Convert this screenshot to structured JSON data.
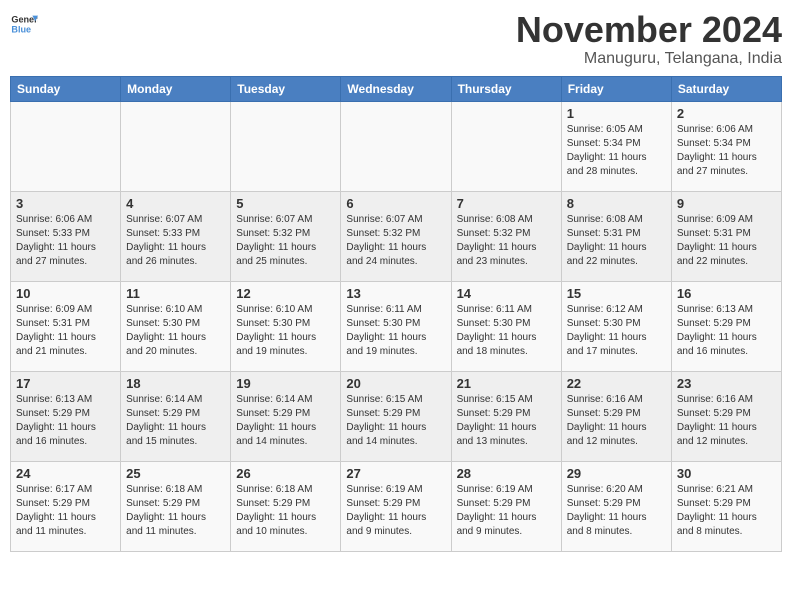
{
  "header": {
    "logo_line1": "General",
    "logo_line2": "Blue",
    "month": "November 2024",
    "location": "Manuguru, Telangana, India"
  },
  "weekdays": [
    "Sunday",
    "Monday",
    "Tuesday",
    "Wednesday",
    "Thursday",
    "Friday",
    "Saturday"
  ],
  "weeks": [
    [
      {
        "day": "",
        "info": ""
      },
      {
        "day": "",
        "info": ""
      },
      {
        "day": "",
        "info": ""
      },
      {
        "day": "",
        "info": ""
      },
      {
        "day": "",
        "info": ""
      },
      {
        "day": "1",
        "info": "Sunrise: 6:05 AM\nSunset: 5:34 PM\nDaylight: 11 hours\nand 28 minutes."
      },
      {
        "day": "2",
        "info": "Sunrise: 6:06 AM\nSunset: 5:34 PM\nDaylight: 11 hours\nand 27 minutes."
      }
    ],
    [
      {
        "day": "3",
        "info": "Sunrise: 6:06 AM\nSunset: 5:33 PM\nDaylight: 11 hours\nand 27 minutes."
      },
      {
        "day": "4",
        "info": "Sunrise: 6:07 AM\nSunset: 5:33 PM\nDaylight: 11 hours\nand 26 minutes."
      },
      {
        "day": "5",
        "info": "Sunrise: 6:07 AM\nSunset: 5:32 PM\nDaylight: 11 hours\nand 25 minutes."
      },
      {
        "day": "6",
        "info": "Sunrise: 6:07 AM\nSunset: 5:32 PM\nDaylight: 11 hours\nand 24 minutes."
      },
      {
        "day": "7",
        "info": "Sunrise: 6:08 AM\nSunset: 5:32 PM\nDaylight: 11 hours\nand 23 minutes."
      },
      {
        "day": "8",
        "info": "Sunrise: 6:08 AM\nSunset: 5:31 PM\nDaylight: 11 hours\nand 22 minutes."
      },
      {
        "day": "9",
        "info": "Sunrise: 6:09 AM\nSunset: 5:31 PM\nDaylight: 11 hours\nand 22 minutes."
      }
    ],
    [
      {
        "day": "10",
        "info": "Sunrise: 6:09 AM\nSunset: 5:31 PM\nDaylight: 11 hours\nand 21 minutes."
      },
      {
        "day": "11",
        "info": "Sunrise: 6:10 AM\nSunset: 5:30 PM\nDaylight: 11 hours\nand 20 minutes."
      },
      {
        "day": "12",
        "info": "Sunrise: 6:10 AM\nSunset: 5:30 PM\nDaylight: 11 hours\nand 19 minutes."
      },
      {
        "day": "13",
        "info": "Sunrise: 6:11 AM\nSunset: 5:30 PM\nDaylight: 11 hours\nand 19 minutes."
      },
      {
        "day": "14",
        "info": "Sunrise: 6:11 AM\nSunset: 5:30 PM\nDaylight: 11 hours\nand 18 minutes."
      },
      {
        "day": "15",
        "info": "Sunrise: 6:12 AM\nSunset: 5:30 PM\nDaylight: 11 hours\nand 17 minutes."
      },
      {
        "day": "16",
        "info": "Sunrise: 6:13 AM\nSunset: 5:29 PM\nDaylight: 11 hours\nand 16 minutes."
      }
    ],
    [
      {
        "day": "17",
        "info": "Sunrise: 6:13 AM\nSunset: 5:29 PM\nDaylight: 11 hours\nand 16 minutes."
      },
      {
        "day": "18",
        "info": "Sunrise: 6:14 AM\nSunset: 5:29 PM\nDaylight: 11 hours\nand 15 minutes."
      },
      {
        "day": "19",
        "info": "Sunrise: 6:14 AM\nSunset: 5:29 PM\nDaylight: 11 hours\nand 14 minutes."
      },
      {
        "day": "20",
        "info": "Sunrise: 6:15 AM\nSunset: 5:29 PM\nDaylight: 11 hours\nand 14 minutes."
      },
      {
        "day": "21",
        "info": "Sunrise: 6:15 AM\nSunset: 5:29 PM\nDaylight: 11 hours\nand 13 minutes."
      },
      {
        "day": "22",
        "info": "Sunrise: 6:16 AM\nSunset: 5:29 PM\nDaylight: 11 hours\nand 12 minutes."
      },
      {
        "day": "23",
        "info": "Sunrise: 6:16 AM\nSunset: 5:29 PM\nDaylight: 11 hours\nand 12 minutes."
      }
    ],
    [
      {
        "day": "24",
        "info": "Sunrise: 6:17 AM\nSunset: 5:29 PM\nDaylight: 11 hours\nand 11 minutes."
      },
      {
        "day": "25",
        "info": "Sunrise: 6:18 AM\nSunset: 5:29 PM\nDaylight: 11 hours\nand 11 minutes."
      },
      {
        "day": "26",
        "info": "Sunrise: 6:18 AM\nSunset: 5:29 PM\nDaylight: 11 hours\nand 10 minutes."
      },
      {
        "day": "27",
        "info": "Sunrise: 6:19 AM\nSunset: 5:29 PM\nDaylight: 11 hours\nand 9 minutes."
      },
      {
        "day": "28",
        "info": "Sunrise: 6:19 AM\nSunset: 5:29 PM\nDaylight: 11 hours\nand 9 minutes."
      },
      {
        "day": "29",
        "info": "Sunrise: 6:20 AM\nSunset: 5:29 PM\nDaylight: 11 hours\nand 8 minutes."
      },
      {
        "day": "30",
        "info": "Sunrise: 6:21 AM\nSunset: 5:29 PM\nDaylight: 11 hours\nand 8 minutes."
      }
    ]
  ]
}
